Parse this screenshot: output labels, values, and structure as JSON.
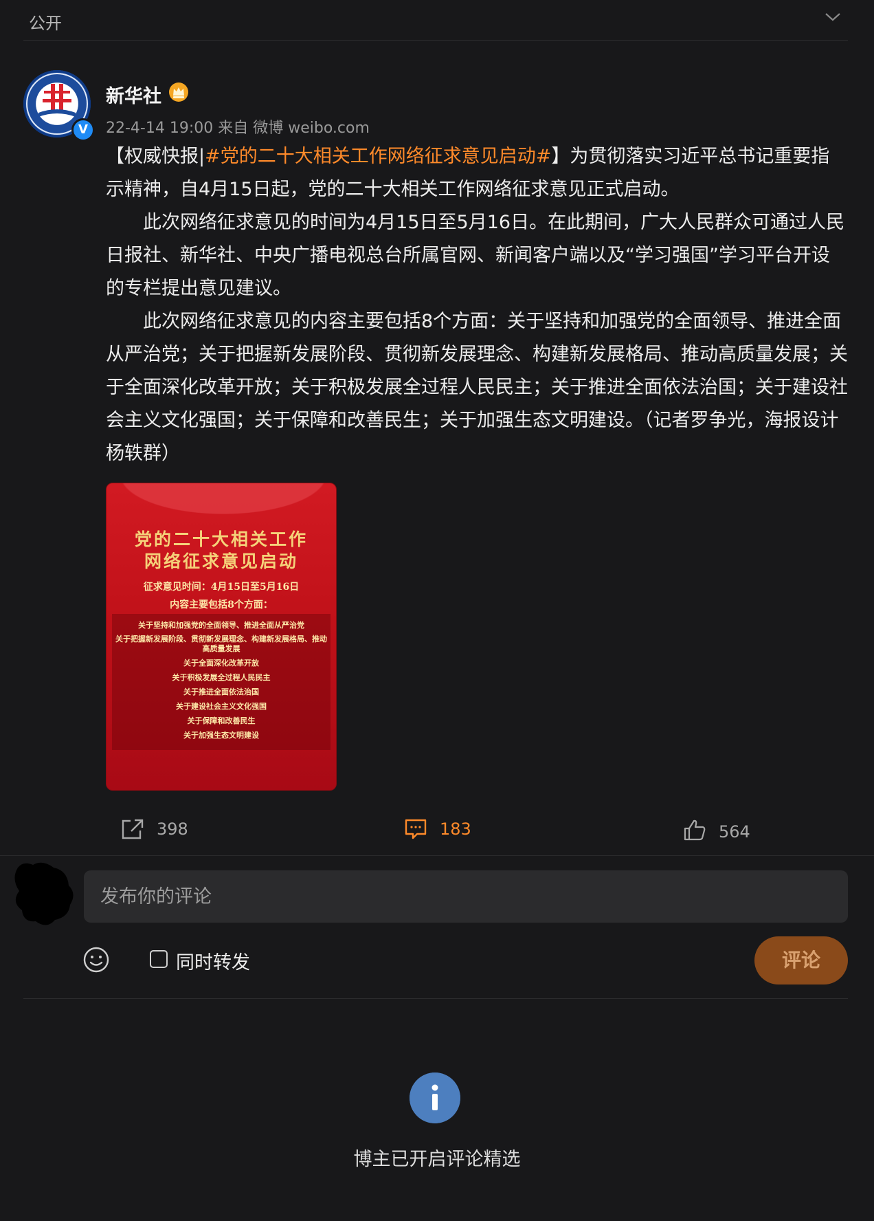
{
  "topbar": {
    "visibility": "公开",
    "chevron_icon": "chevron-down-icon"
  },
  "post": {
    "author": "新华社",
    "author_badge_icon": "crown-icon",
    "verified_icon": "verified-badge-icon",
    "verified_mark": "V",
    "timestamp": "22-4-14 19:00",
    "source": "来自 微博 weibo.com",
    "para1_prefix": "【权威快报|",
    "para1_hashtag": "#党的二十大相关工作网络征求意见启动#",
    "para1_rest": "】为贯彻落实习近平总书记重要指示精神，自4月15日起，党的二十大相关工作网络征求意见正式启动。",
    "para2": "此次网络征求意见的时间为4月15日至5月16日。在此期间，广大人民群众可通过人民日报社、新华社、中央广播电视总台所属官网、新闻客户端以及“学习强国”学习平台开设的专栏提出意见建议。",
    "para3": "此次网络征求意见的内容主要包括8个方面：关于坚持和加强党的全面领导、推进全面从严治党；关于把握新发展阶段、贯彻新发展理念、构建新发展格局、推动高质量发展；关于全面深化改革开放；关于积极发展全过程人民民主；关于推进全面依法治国；关于建设社会主义文化强国；关于保障和改善民生；关于加强生态文明建设。（记者罗争光，海报设计杨轶群）"
  },
  "poster": {
    "title_line1": "党的二十大相关工作",
    "title_line2": "网络征求意见启动",
    "time_line": "征求意见时间：4月15日至5月16日",
    "content_intro": "内容主要包括8个方面：",
    "items": [
      "关于坚持和加强党的全面领导、推进全面从严治党",
      "关于把握新发展阶段、贯彻新发展理念、构建新发展格局、推动高质量发展",
      "关于全面深化改革开放",
      "关于积极发展全过程人民民主",
      "关于推进全面依法治国",
      "关于建设社会主义文化强国",
      "关于保障和改善民生",
      "关于加强生态文明建设"
    ]
  },
  "actions": {
    "repost_icon": "share-icon",
    "repost_count": "398",
    "comment_icon": "comment-icon",
    "comment_count": "183",
    "like_icon": "thumbs-up-icon",
    "like_count": "564",
    "accent_color": "#ff8a2a"
  },
  "comment_box": {
    "placeholder": "发布你的评论",
    "emoji_icon": "smiley-icon",
    "repost_checkbox_label": "同时转发",
    "repost_checked": false,
    "submit_label": "评论"
  },
  "notice": {
    "icon": "info-icon",
    "text": "博主已开启评论精选"
  }
}
